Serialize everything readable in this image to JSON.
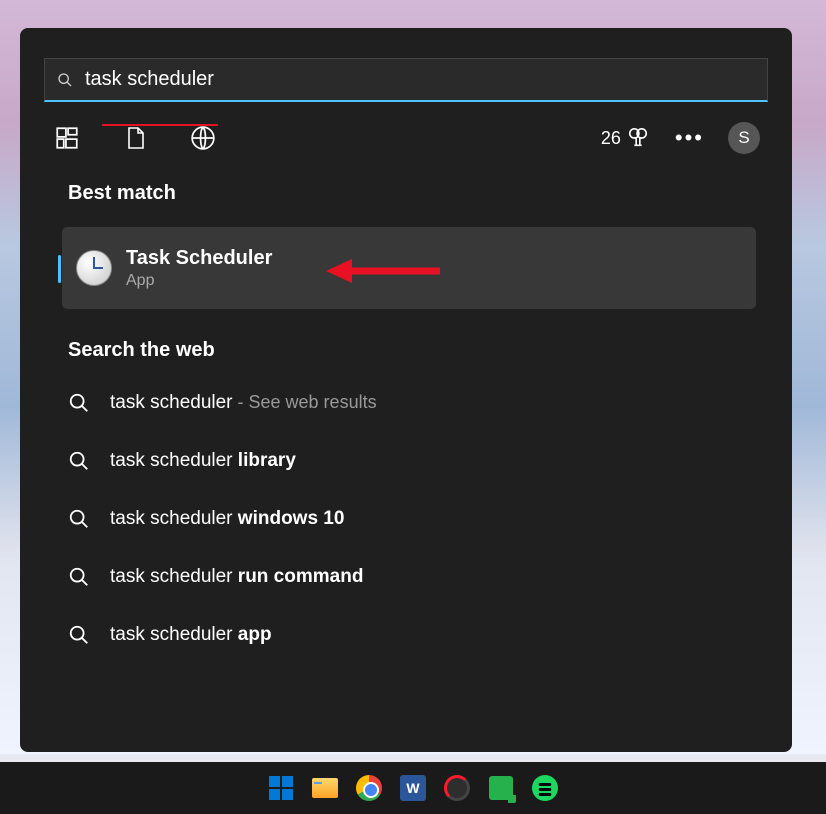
{
  "search": {
    "query": "task scheduler"
  },
  "toolbar": {
    "rewards_count": "26",
    "avatar_initial": "S"
  },
  "sections": {
    "best_match_title": "Best match",
    "web_title": "Search the web"
  },
  "best_match": {
    "title": "Task Scheduler",
    "subtitle": "App"
  },
  "web_results": [
    {
      "prefix": "task scheduler",
      "bold": "",
      "sub": " - See web results"
    },
    {
      "prefix": "task scheduler ",
      "bold": "library",
      "sub": ""
    },
    {
      "prefix": "task scheduler ",
      "bold": "windows 10",
      "sub": ""
    },
    {
      "prefix": "task scheduler ",
      "bold": "run command",
      "sub": ""
    },
    {
      "prefix": "task scheduler ",
      "bold": "app",
      "sub": ""
    }
  ],
  "taskbar_icons": [
    "start",
    "explorer",
    "chrome",
    "word",
    "opera",
    "chat",
    "spotify"
  ]
}
